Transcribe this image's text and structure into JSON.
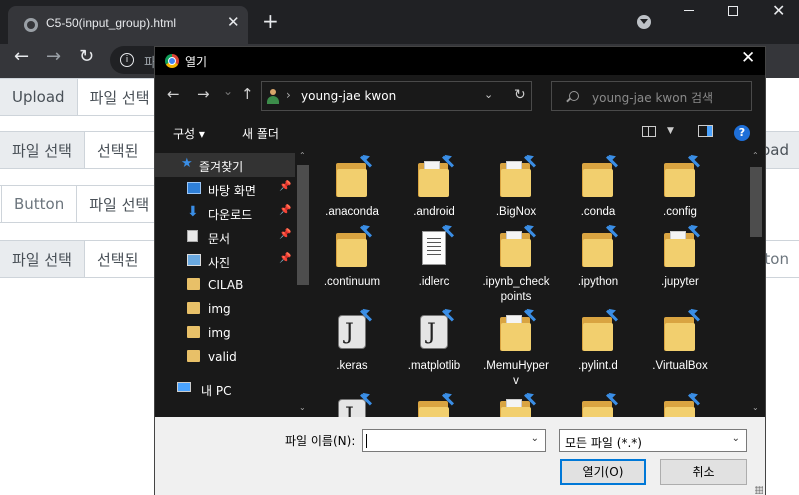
{
  "browser": {
    "tab_title": "C5-50(input_group).html",
    "tab_close": "✕",
    "new_tab": "+",
    "back": "←",
    "forward": "→",
    "reload": "↻",
    "info": "i",
    "url_visible": "파",
    "window_close": "✕"
  },
  "page": {
    "row1": {
      "button": "Upload",
      "addon": "파일 선택"
    },
    "row2": {
      "addon": "파일 선택",
      "text": "선택된",
      "button_tail": "oad"
    },
    "row3": {
      "button": "Button",
      "addon": "파일 선택"
    },
    "row4": {
      "addon": "파일 선택",
      "text": "선택된",
      "button_tail": "tton"
    }
  },
  "dialog": {
    "title": "열기",
    "close": "✕",
    "nav_back": "←",
    "nav_forward": "→",
    "nav_recent": "⌄",
    "nav_up": "↑",
    "address_sep": "›",
    "address": "young-jae kwon",
    "address_drop": "⌄",
    "address_refresh": "↻",
    "search_placeholder": "young-jae kwon 검색",
    "commands": {
      "organize": "구성 ▾",
      "new_folder": "새 폴더",
      "help": "?"
    },
    "nav_items": [
      {
        "label": "즐겨찾기",
        "icon": "star-icon",
        "pin": ""
      },
      {
        "label": "바탕 화면",
        "icon": "desktop-icon",
        "pin": "📌"
      },
      {
        "label": "다운로드",
        "icon": "download-icon",
        "pin": "📌"
      },
      {
        "label": "문서",
        "icon": "document-icon",
        "pin": "📌"
      },
      {
        "label": "사진",
        "icon": "pictures-icon",
        "pin": "📌"
      },
      {
        "label": "CILAB",
        "icon": "folder-icon",
        "pin": ""
      },
      {
        "label": "img",
        "icon": "folder-icon",
        "pin": ""
      },
      {
        "label": "img",
        "icon": "folder-icon",
        "pin": ""
      },
      {
        "label": "valid",
        "icon": "folder-icon",
        "pin": ""
      },
      {
        "label": "내 PC",
        "icon": "pc-icon",
        "pin": ""
      }
    ],
    "files": [
      {
        "name": ".anaconda",
        "icon": "folder"
      },
      {
        "name": ".android",
        "icon": "folder-doc"
      },
      {
        "name": ".BigNox",
        "icon": "folder-doc"
      },
      {
        "name": ".conda",
        "icon": "folder"
      },
      {
        "name": ".config",
        "icon": "folder"
      },
      {
        "name": ".continuum",
        "icon": "folder"
      },
      {
        "name": ".idlerc",
        "icon": "document"
      },
      {
        "name": ".ipynb_checkpoints",
        "icon": "folder-doc"
      },
      {
        "name": ".ipython",
        "icon": "folder"
      },
      {
        "name": ".jupyter",
        "icon": "folder-doc"
      },
      {
        "name": ".keras",
        "icon": "keras"
      },
      {
        "name": ".matplotlib",
        "icon": "keras"
      },
      {
        "name": ".MemuHyperv",
        "icon": "folder-doc"
      },
      {
        "name": ".pylint.d",
        "icon": "folder"
      },
      {
        "name": ".VirtualBox",
        "icon": "folder"
      },
      {
        "name": "",
        "icon": "keras"
      },
      {
        "name": "",
        "icon": "folder"
      },
      {
        "name": "",
        "icon": "folder-doc"
      },
      {
        "name": "",
        "icon": "folder"
      },
      {
        "name": "",
        "icon": "folder"
      }
    ],
    "filename_label": "파일 이름(N):",
    "filename_value": "",
    "filetype": "모든 파일 (*.*)",
    "open_button": "열기(O)",
    "cancel_button": "취소",
    "dropdown_arrow": "⌄"
  }
}
